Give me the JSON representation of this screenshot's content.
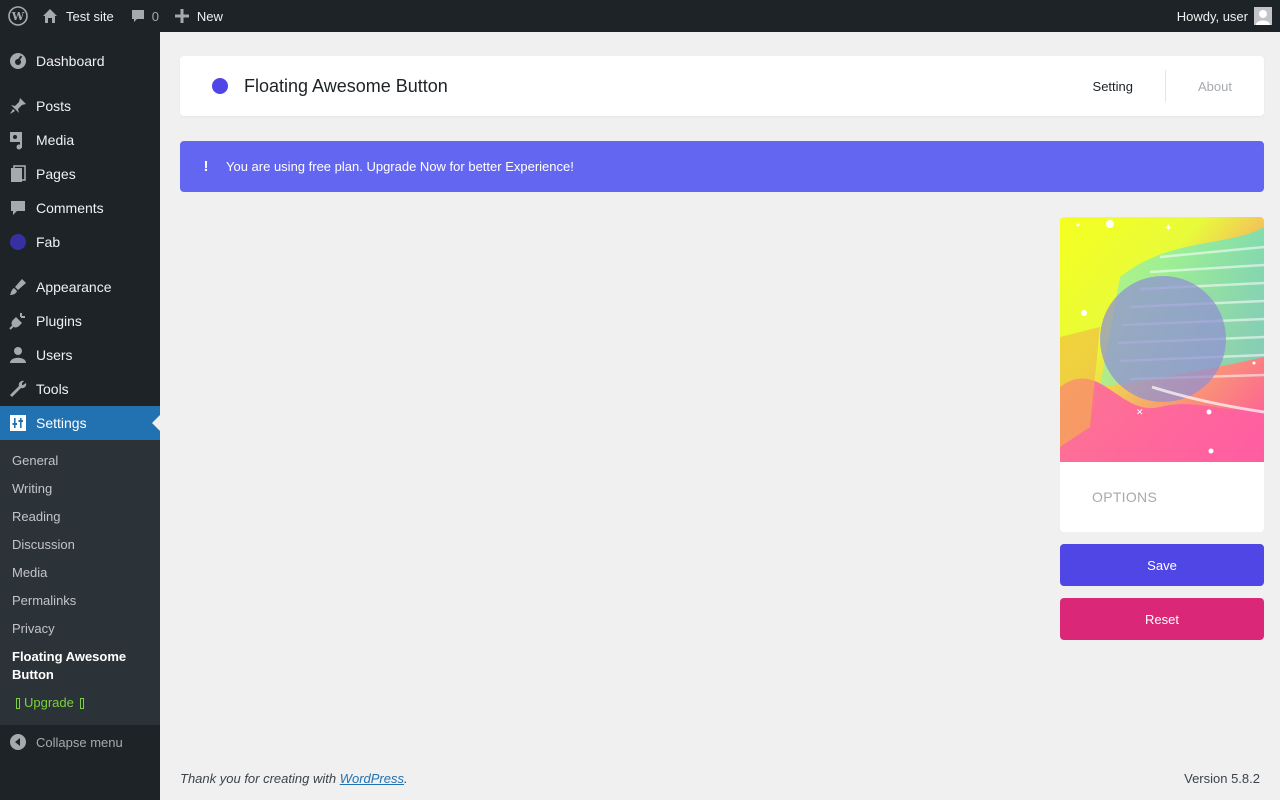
{
  "adminbar": {
    "site_name": "Test site",
    "comments_count": "0",
    "new_label": "New",
    "howdy": "Howdy, user"
  },
  "sidebar": {
    "items": [
      {
        "label": "Dashboard",
        "icon": "dashboard-icon"
      },
      {
        "label": "Posts",
        "icon": "pin-icon"
      },
      {
        "label": "Media",
        "icon": "media-icon"
      },
      {
        "label": "Pages",
        "icon": "pages-icon"
      },
      {
        "label": "Comments",
        "icon": "comment-icon"
      },
      {
        "label": "Fab",
        "icon": "fab-dot-icon"
      },
      {
        "label": "Appearance",
        "icon": "brush-icon"
      },
      {
        "label": "Plugins",
        "icon": "plug-icon"
      },
      {
        "label": "Users",
        "icon": "user-icon"
      },
      {
        "label": "Tools",
        "icon": "wrench-icon"
      },
      {
        "label": "Settings",
        "icon": "sliders-icon"
      }
    ],
    "submenu": [
      "General",
      "Writing",
      "Reading",
      "Discussion",
      "Media",
      "Permalinks",
      "Privacy"
    ],
    "current_sub": "Floating Awesome Button",
    "upgrade_label": "Upgrade",
    "collapse_label": "Collapse menu"
  },
  "header": {
    "title": "Floating Awesome Button",
    "tabs": [
      "Setting",
      "About"
    ]
  },
  "notice": {
    "icon": "!",
    "text": "You are using free plan. Upgrade Now for better Experience!"
  },
  "panel": {
    "options_label": "OPTIONS",
    "save_label": "Save",
    "reset_label": "Reset"
  },
  "footer": {
    "thanks_prefix": "Thank you for creating with ",
    "thanks_link": "WordPress",
    "thanks_suffix": ".",
    "version": "Version 5.8.2"
  },
  "colors": {
    "adminbar": "#1d2327",
    "active_menu": "#2271b1",
    "fab_primary": "#4f46e5",
    "notice": "#6366f1",
    "reset": "#db2777"
  }
}
